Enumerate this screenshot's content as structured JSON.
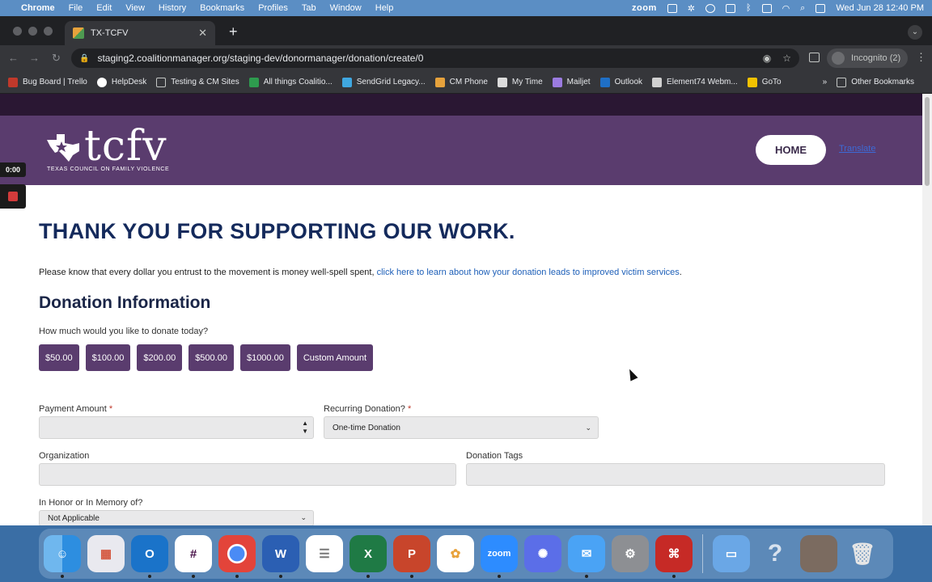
{
  "menubar": {
    "app": "Chrome",
    "items": [
      "File",
      "Edit",
      "View",
      "History",
      "Bookmarks",
      "Profiles",
      "Tab",
      "Window",
      "Help"
    ],
    "zoom": "zoom",
    "clock": "Wed Jun 28  12:40 PM"
  },
  "browser": {
    "tab_title": "TX-TCFV",
    "url": "staging2.coalitionmanager.org/staging-dev/donormanager/donation/create/0",
    "incognito": "Incognito (2)",
    "bookmarks": [
      "Bug Board | Trello",
      "HelpDesk",
      "Testing & CM Sites",
      "All things Coalitio...",
      "SendGrid Legacy...",
      "CM Phone",
      "My Time",
      "Mailjet",
      "Outlook",
      "Element74 Webm...",
      "GoTo"
    ],
    "bookmarks_more": "»",
    "other_bookmarks": "Other Bookmarks"
  },
  "recorder": {
    "time": "0:00"
  },
  "header": {
    "logo_word": "tcfv",
    "logo_sub": "TEXAS COUNCIL ON FAMILY VIOLENCE",
    "home": "HOME",
    "translate": "Translate"
  },
  "main": {
    "title": "THANK YOU FOR SUPPORTING OUR WORK.",
    "intro_text": "Please know that every dollar you entrust to the movement is money well-spell spent, ",
    "intro_link": "click here to learn about how your donation leads to improved victim services",
    "intro_end": ".",
    "section_title": "Donation Information",
    "question": "How much would you like to donate today?",
    "amounts": [
      "$50.00",
      "$100.00",
      "$200.00",
      "$500.00",
      "$1000.00",
      "Custom Amount"
    ],
    "payment_label": "Payment Amount",
    "recurring_label": "Recurring Donation?",
    "recurring_value": "One-time Donation",
    "org_label": "Organization",
    "tags_label": "Donation Tags",
    "honor_label": "In Honor or In Memory of?",
    "honor_value": "Not Applicable",
    "required_mark": "*"
  },
  "dock": {
    "apps": [
      "finder-icon",
      "launchpad-icon",
      "outlook-icon",
      "slack-icon",
      "chrome-icon",
      "word-icon",
      "reminders-icon",
      "excel-icon",
      "powerpoint-icon",
      "photos-icon",
      "zoom-icon",
      "zoom-settings-icon",
      "mail-icon",
      "system-settings-icon",
      "acrobat-icon"
    ],
    "zoom_label": "zoom"
  },
  "colors": {
    "purple": "#5a3c6e",
    "dark_band": "#2a1733",
    "title_navy": "#142a5c",
    "link": "#1d5fb8"
  }
}
